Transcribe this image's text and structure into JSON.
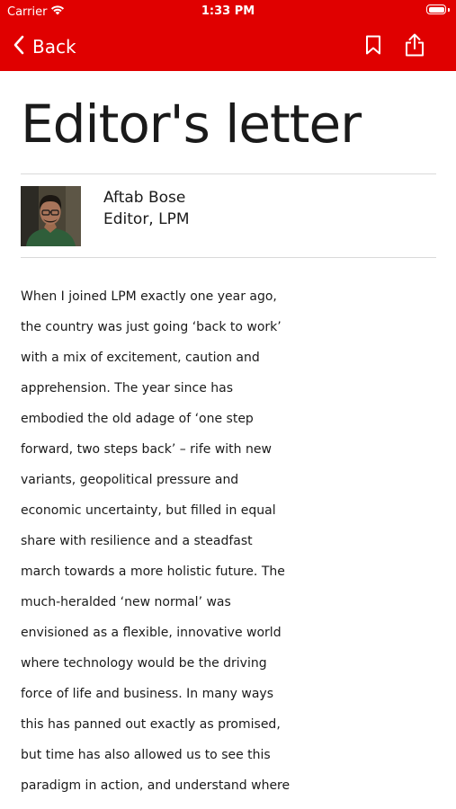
{
  "status_bar": {
    "carrier": "Carrier",
    "time": "1:33 PM"
  },
  "nav": {
    "back_label": "Back"
  },
  "article": {
    "title": "Editor's letter",
    "author_name": "Aftab Bose",
    "author_role": "Editor, LPM",
    "body_lines": [
      "When I joined LPM exactly one year ago,",
      "the country was just going ‘back to work’",
      "with a mix of excitement, caution and",
      "apprehension. The year since has",
      "embodied the old adage of ‘one step",
      "forward, two steps back’ – rife with new",
      "variants, geopolitical pressure and",
      "economic uncertainty, but filled in equal",
      "share with resilience and a steadfast",
      "march towards a more holistic future. The",
      "much-heralded ‘new normal’ was",
      "envisioned as a flexible, innovative world",
      "where technology would be the driving",
      "force of life and business. In many ways",
      "this has panned out exactly as promised,",
      "but time has also allowed us to see this",
      "paradigm in action, and understand where"
    ]
  },
  "colors": {
    "brand_red": "#e00000",
    "text": "#1a1a1a",
    "divider": "#d9d9d9"
  },
  "icons": [
    "wifi-icon",
    "battery-icon",
    "chevron-left-icon",
    "bookmark-icon",
    "share-icon"
  ]
}
